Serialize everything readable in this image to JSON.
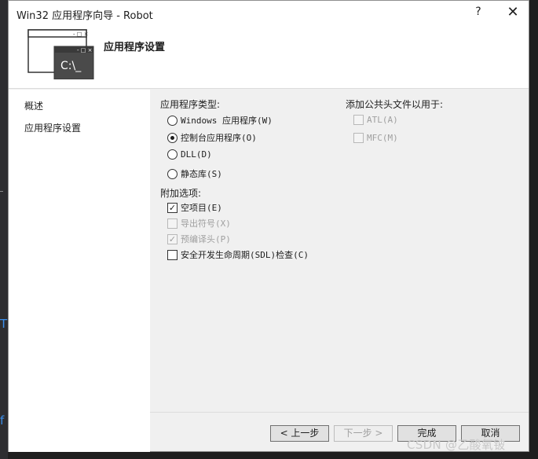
{
  "window": {
    "title": "Win32 应用程序向导 - Robot",
    "help_label": "?",
    "close_label": "✕"
  },
  "banner": {
    "title": "应用程序设置",
    "icon_text": "C:\\_",
    "icon_buttons": "- □ ×"
  },
  "nav": {
    "items": [
      {
        "label": "概述"
      },
      {
        "label": "应用程序设置"
      }
    ]
  },
  "app_type": {
    "heading": "应用程序类型:",
    "options": [
      {
        "label": "Windows 应用程序(W)",
        "selected": false
      },
      {
        "label": "控制台应用程序(O)",
        "selected": true
      },
      {
        "label": "DLL(D)",
        "selected": false
      },
      {
        "label": "静态库(S)",
        "selected": false
      }
    ]
  },
  "extra_options": {
    "heading": "附加选项:",
    "options": [
      {
        "label": "空项目(E)",
        "checked": true,
        "enabled": true
      },
      {
        "label": "导出符号(X)",
        "checked": false,
        "enabled": false
      },
      {
        "label": "预编译头(P)",
        "checked": true,
        "enabled": false
      },
      {
        "label": "安全开发生命周期(SDL)检查(C)",
        "checked": false,
        "enabled": true
      }
    ]
  },
  "common_headers": {
    "heading": "添加公共头文件以用于:",
    "options": [
      {
        "label": "ATL(A)",
        "checked": false,
        "enabled": false
      },
      {
        "label": "MFC(M)",
        "checked": false,
        "enabled": false
      }
    ]
  },
  "footer": {
    "prev_label": "< 上一步",
    "next_label": "下一步 >",
    "finish_label": "完成",
    "cancel_label": "取消"
  },
  "watermark": "CSDN @乙酸氧铍",
  "edge": {
    "glyph_top": "T",
    "glyph_bottom": "f"
  }
}
